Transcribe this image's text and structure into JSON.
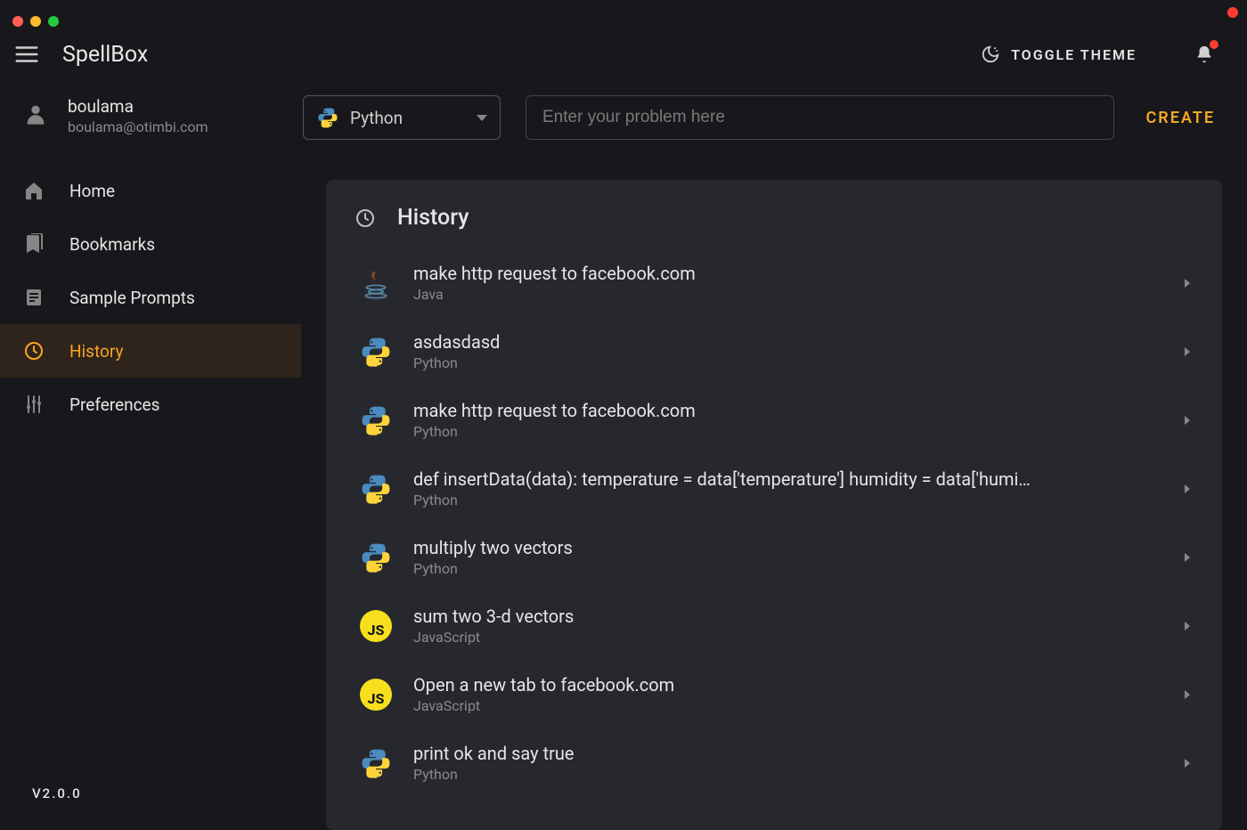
{
  "app": {
    "title": "SpellBox"
  },
  "header": {
    "toggle_theme_label": "TOGGLE THEME"
  },
  "user": {
    "name": "boulama",
    "email": "boulama@otimbi.com"
  },
  "sidebar": {
    "items": [
      {
        "label": "Home",
        "icon": "home-icon",
        "active": false
      },
      {
        "label": "Bookmarks",
        "icon": "bookmarks-icon",
        "active": false
      },
      {
        "label": "Sample Prompts",
        "icon": "document-icon",
        "active": false
      },
      {
        "label": "History",
        "icon": "history-icon",
        "active": true
      },
      {
        "label": "Preferences",
        "icon": "sliders-icon",
        "active": false
      }
    ],
    "version": "V2.0.0"
  },
  "prompt_bar": {
    "language_selected": "Python",
    "input_placeholder": "Enter your problem here",
    "create_label": "CREATE"
  },
  "history": {
    "title": "History",
    "items": [
      {
        "prompt": "make http request to facebook.com",
        "language": "Java"
      },
      {
        "prompt": "asdasdasd",
        "language": "Python"
      },
      {
        "prompt": "make http request to facebook.com",
        "language": "Python"
      },
      {
        "prompt": "def insertData(data): temperature = data['temperature'] humidity = data['humi…",
        "language": "Python"
      },
      {
        "prompt": "multiply two vectors",
        "language": "Python"
      },
      {
        "prompt": "sum two 3-d vectors",
        "language": "JavaScript"
      },
      {
        "prompt": "Open a new tab to facebook.com",
        "language": "JavaScript"
      },
      {
        "prompt": "print ok and say true",
        "language": "Python"
      }
    ]
  },
  "colors": {
    "accent": "#f5a623",
    "bg": "#18181c",
    "panel": "#26282e"
  }
}
